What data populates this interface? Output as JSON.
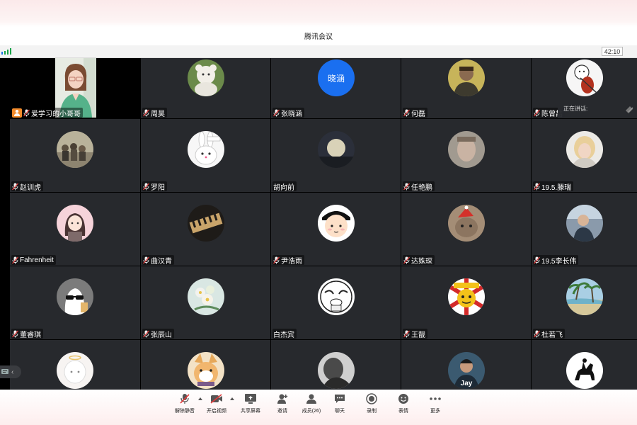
{
  "window": {
    "title": "腾讯会议"
  },
  "status": {
    "timer": "42:10"
  },
  "speaking": {
    "label": "正在讲话:"
  },
  "participants": [
    {
      "name": "爱学习的小哥哥",
      "avatar": "video",
      "host": true
    },
    {
      "name": "周昊",
      "avatar": "plush-bear"
    },
    {
      "name": "张晓涵",
      "avatar": "text",
      "avatar_text": "晓涵",
      "color": "#1a6ff0"
    },
    {
      "name": "何磊",
      "avatar": "portrait-man"
    },
    {
      "name": "陈曾喆",
      "avatar": "cartoon-violin"
    },
    {
      "name": "赵训虎",
      "avatar": "group-photo"
    },
    {
      "name": "罗阳",
      "avatar": "rabbit"
    },
    {
      "name": "胡向前",
      "avatar": "moon",
      "no_mic": true
    },
    {
      "name": "任艳鹏",
      "avatar": "blurry-face"
    },
    {
      "name": "19.5.滕瑞",
      "avatar": "blonde-person"
    },
    {
      "name": "Fahrenheit",
      "avatar": "cartoon-girl"
    },
    {
      "name": "曲汉青",
      "avatar": "piano"
    },
    {
      "name": "尹浩雨",
      "avatar": "cartoon-face"
    },
    {
      "name": "达姝琛",
      "avatar": "christmas-cat"
    },
    {
      "name": "19.5李长伟",
      "avatar": "person-photo"
    },
    {
      "name": "董睿琪",
      "avatar": "cool-duck"
    },
    {
      "name": "张辰山",
      "avatar": "flowers"
    },
    {
      "name": "白杰宾",
      "avatar": "meme-face",
      "no_mic": true
    },
    {
      "name": "王靓",
      "avatar": "sun-meme"
    },
    {
      "name": "杜若飞",
      "avatar": "beach"
    },
    {
      "name": "",
      "avatar": "white-cartoon"
    },
    {
      "name": "",
      "avatar": "cartoon-dog"
    },
    {
      "name": "",
      "avatar": "dark-portrait"
    },
    {
      "name": "",
      "avatar": "jay-photo",
      "avatar_text": "Jay"
    },
    {
      "name": "",
      "avatar": "horse-rider"
    }
  ],
  "toolbar": {
    "unmute": "解除静音",
    "start_video": "开启视频",
    "share_screen": "共享屏幕",
    "invite": "邀请",
    "members": "成员(26)",
    "chat": "聊天",
    "record": "录制",
    "reactions": "表情",
    "more": "更多"
  }
}
